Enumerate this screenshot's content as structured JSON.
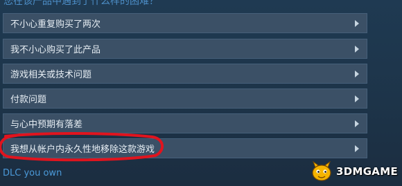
{
  "header": {
    "question": "您在该产品中遇到了什么样的困难？"
  },
  "options": [
    {
      "label": "不小心重复购买了两次"
    },
    {
      "label": "我不小心购买了此产品"
    },
    {
      "label": "游戏相关或技术问题"
    },
    {
      "label": "付款问题"
    },
    {
      "label": "与心中预期有落差"
    },
    {
      "label": "我想从帐户内永久性地移除这款游戏"
    }
  ],
  "dlc_link": "DLC you own",
  "watermark": {
    "text": "3DMGAME"
  },
  "colors": {
    "option_bg": "#3b5066",
    "link": "#4b9ad9",
    "annotation": "#e0141e"
  }
}
